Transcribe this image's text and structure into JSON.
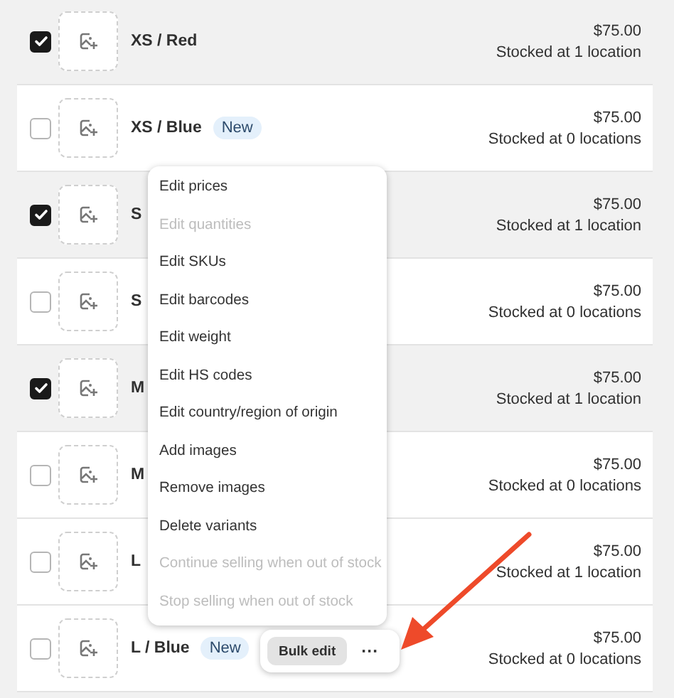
{
  "variants": [
    {
      "name": "XS / Red",
      "checked": true,
      "price": "$75.00",
      "stock": "Stocked at 1 location"
    },
    {
      "name": "XS / Blue",
      "badge": "New",
      "checked": false,
      "price": "$75.00",
      "stock": "Stocked at 0 locations"
    },
    {
      "name": "S",
      "checked": true,
      "price": "$75.00",
      "stock": "Stocked at 1 location"
    },
    {
      "name": "S",
      "checked": false,
      "price": "$75.00",
      "stock": "Stocked at 0 locations"
    },
    {
      "name": "M",
      "checked": true,
      "price": "$75.00",
      "stock": "Stocked at 1 location"
    },
    {
      "name": "M",
      "checked": false,
      "price": "$75.00",
      "stock": "Stocked at 0 locations"
    },
    {
      "name": "L",
      "checked": false,
      "price": "$75.00",
      "stock": "Stocked at 1 location"
    },
    {
      "name": "L / Blue",
      "badge": "New",
      "checked": false,
      "price": "$75.00",
      "stock": "Stocked at 0 locations"
    }
  ],
  "menu": [
    {
      "label": "Edit prices",
      "disabled": false
    },
    {
      "label": "Edit quantities",
      "disabled": true
    },
    {
      "label": "Edit SKUs",
      "disabled": false
    },
    {
      "label": "Edit barcodes",
      "disabled": false
    },
    {
      "label": "Edit weight",
      "disabled": false
    },
    {
      "label": "Edit HS codes",
      "disabled": false
    },
    {
      "label": "Edit country/region of origin",
      "disabled": false
    },
    {
      "label": "Add images",
      "disabled": false
    },
    {
      "label": "Remove images",
      "disabled": false
    },
    {
      "label": "Delete variants",
      "disabled": false
    },
    {
      "label": "Continue selling when out of stock",
      "disabled": true
    },
    {
      "label": "Stop selling when out of stock",
      "disabled": true
    }
  ],
  "bulk_bar": {
    "button": "Bulk edit",
    "more": "···"
  }
}
